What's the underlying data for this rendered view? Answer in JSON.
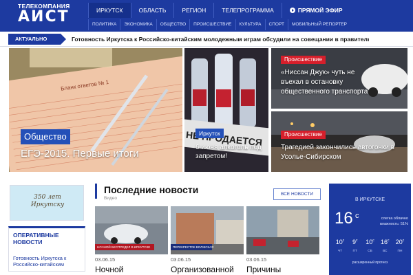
{
  "header": {
    "logo_top": "ТЕЛЕКОМПАНИЯ",
    "logo_main": "АИСТ",
    "nav": [
      "ИРКУТСК",
      "ОБЛАСТЬ",
      "РЕГИОН",
      "ТЕЛЕПРОГРАММА"
    ],
    "live_label": "ПРЯМОЙ ЭФИР",
    "subnav": [
      "ПОЛИТИКА",
      "ЭКОНОМИКА",
      "ОБЩЕСТВО",
      "ПРОИСШЕСТВИЕ",
      "КУЛЬТУРА",
      "СПОРТ",
      "МОБИЛЬНЫЙ РЕПОРТЕР"
    ]
  },
  "ticker": {
    "label": "АКТУАЛЬНО",
    "text": "Готовность Иркутска к Российско-китайским молодежным играм обсудили на совещании в правительстве"
  },
  "hero": {
    "main": {
      "badge": "Общество",
      "title": "ЕГЭ-2015. Первые итоги",
      "sign_text": "Бланк ответов № 1"
    },
    "second": {
      "badge": "Иркутск",
      "title": "6 июня алкоголь под запретом!",
      "sign_text": "НЕ ПРОДАЕТСЯ"
    },
    "third": {
      "badge": "Происшествие",
      "title": "«Ниссан Джук» чуть не въехал в остановку общественного транспорта"
    },
    "fourth": {
      "badge": "Происшествие",
      "title": "Трагедией закончились автогонки в Усолье-Сибирском"
    }
  },
  "sidebar": {
    "banner_text": "350 лет Иркутску",
    "operative_title": "ОПЕРАТИВНЫЕ НОВОСТИ",
    "operative_item": "Готовность Иркутска к Российско-китайским"
  },
  "news": {
    "title": "Последние новости",
    "subtitle": "Видео",
    "all_button": "ВСЕ НОВОСТИ",
    "items": [
      {
        "date": "03.06.15",
        "title": "Ночной",
        "caption": "НОЧНОЙ БЕСПРЕДЕЛ В ИРКУТСКЕ"
      },
      {
        "date": "03.06.15",
        "title": "Организованной",
        "caption": "ПЕРЕКРЕСТОК ВОЛЖСКАЯ"
      },
      {
        "date": "03.06.15",
        "title": "Причины",
        "caption": ""
      }
    ]
  },
  "weather": {
    "city": "В ИРКУТСКЕ",
    "temp": "16",
    "unit": "c",
    "desc_line1": "слегка облачно",
    "desc_line2": "влажность: 51%",
    "forecast": [
      {
        "temp": "10",
        "unit": "c",
        "day": "ЧТ"
      },
      {
        "temp": "9",
        "unit": "c",
        "day": "ПТ"
      },
      {
        "temp": "10",
        "unit": "c",
        "day": "СБ"
      },
      {
        "temp": "16",
        "unit": "c",
        "day": "ВС"
      },
      {
        "temp": "20",
        "unit": "c",
        "day": "ПН"
      }
    ],
    "extended_link": "расширенный прогноз"
  },
  "colors": {
    "brand_blue": "#1d3aa0",
    "badge_blue": "#2450b8",
    "badge_red": "#d61f2b"
  }
}
